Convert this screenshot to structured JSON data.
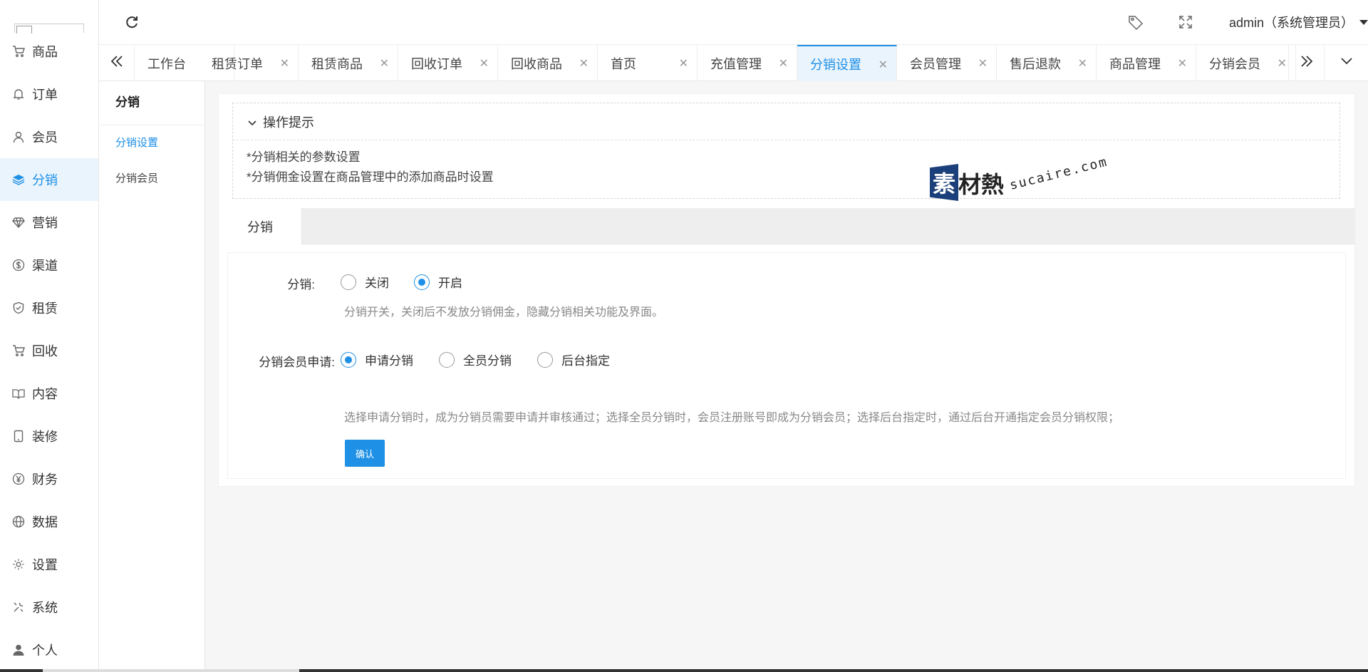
{
  "sidebar": {
    "items": [
      {
        "label": "商品",
        "icon": "cart-icon"
      },
      {
        "label": "订单",
        "icon": "bell-icon"
      },
      {
        "label": "会员",
        "icon": "user-icon"
      },
      {
        "label": "分销",
        "icon": "layers-icon",
        "active": true
      },
      {
        "label": "营销",
        "icon": "diamond-icon"
      },
      {
        "label": "渠道",
        "icon": "dollar-icon"
      },
      {
        "label": "租赁",
        "icon": "shield-icon"
      },
      {
        "label": "回收",
        "icon": "cart-icon"
      },
      {
        "label": "内容",
        "icon": "book-icon"
      },
      {
        "label": "装修",
        "icon": "tablet-icon"
      },
      {
        "label": "财务",
        "icon": "yen-icon"
      },
      {
        "label": "数据",
        "icon": "globe-icon"
      },
      {
        "label": "设置",
        "icon": "gear-icon"
      },
      {
        "label": "系统",
        "icon": "tools-icon"
      },
      {
        "label": "个人",
        "icon": "person-icon"
      }
    ]
  },
  "header": {
    "user": "admin（系统管理员）"
  },
  "tabs": [
    {
      "label": "工作台",
      "closable": false
    },
    {
      "label": "租赁订单",
      "closable": true
    },
    {
      "label": "租赁商品",
      "closable": true
    },
    {
      "label": "回收订单",
      "closable": true
    },
    {
      "label": "回收商品",
      "closable": true
    },
    {
      "label": "首页",
      "closable": true
    },
    {
      "label": "充值管理",
      "closable": true
    },
    {
      "label": "分销设置",
      "closable": true,
      "active": true
    },
    {
      "label": "会员管理",
      "closable": true
    },
    {
      "label": "售后退款",
      "closable": true
    },
    {
      "label": "商品管理",
      "closable": true
    },
    {
      "label": "分销会员",
      "closable": true
    }
  ],
  "subnav": {
    "title": "分销",
    "items": [
      {
        "label": "分销设置",
        "active": true
      },
      {
        "label": "分销会员"
      }
    ]
  },
  "tips": {
    "title": "操作提示",
    "lines": [
      "*分销相关的参数设置",
      "*分销佣金设置在商品管理中的添加商品时设置"
    ]
  },
  "watermark": {
    "badge": "素",
    "text": "材熱",
    "domain": "sucaire.com"
  },
  "section_tab": "分销",
  "form": {
    "distribution": {
      "label": "分销:",
      "options": [
        {
          "label": "关闭",
          "checked": false
        },
        {
          "label": "开启",
          "checked": true
        }
      ],
      "hint": "分销开关，关闭后不发放分销佣金，隐藏分销相关功能及界面。"
    },
    "apply": {
      "label": "分销会员申请:",
      "options": [
        {
          "label": "申请分销",
          "checked": true
        },
        {
          "label": "全员分销",
          "checked": false
        },
        {
          "label": "后台指定",
          "checked": false
        }
      ],
      "hint": "选择申请分销时，成为分销员需要申请并审核通过；选择全员分销时，会员注册账号即成为分销会员；选择后台指定时，通过后台开通指定会员分销权限；"
    },
    "confirm_label": "确认"
  },
  "colors": {
    "accent": "#1e90e6",
    "active_bg": "#eaf4fd"
  }
}
